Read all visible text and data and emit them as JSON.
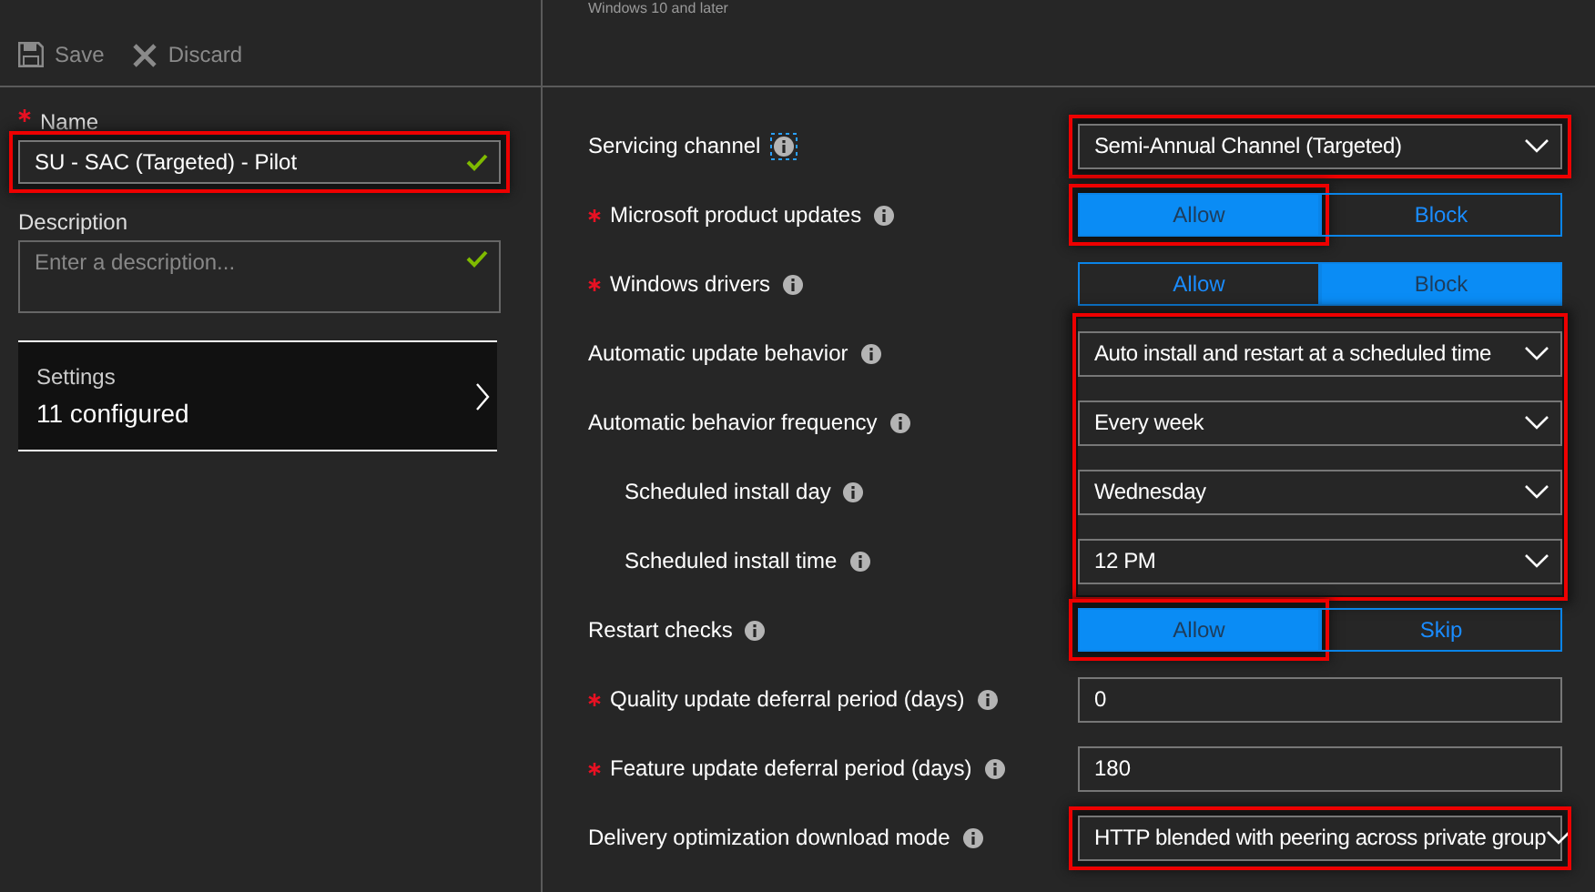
{
  "left": {
    "toolbar": [
      {
        "kind": "save",
        "label": "Save",
        "disabled": true
      },
      {
        "kind": "discard",
        "label": "Discard",
        "disabled": true
      }
    ],
    "name": {
      "label": "Name",
      "required": true,
      "value": "SU - SAC (Targeted) - Pilot",
      "valid": true,
      "highlighted": true
    },
    "description": {
      "label": "Description",
      "placeholder": "Enter a description...",
      "valid": true
    },
    "settings_card": {
      "title": "Settings",
      "value": "11 configured"
    }
  },
  "platform": "Windows 10 and later",
  "rows": [
    {
      "kind": "dropdown",
      "label": "Servicing channel",
      "required": false,
      "info_focused": true,
      "value": "Semi-Annual Channel (Targeted)",
      "highlighted": true
    },
    {
      "kind": "toggle",
      "label": "Microsoft product updates",
      "required": true,
      "info_focused": false,
      "options": [
        {
          "label": "Allow",
          "selected": true
        },
        {
          "label": "Block",
          "selected": false
        }
      ],
      "highlighted": true
    },
    {
      "kind": "toggle",
      "label": "Windows drivers",
      "required": true,
      "info_focused": false,
      "options": [
        {
          "label": "Allow",
          "selected": false
        },
        {
          "label": "Block",
          "selected": true
        }
      ],
      "highlighted": false
    },
    {
      "kind": "group",
      "highlighted": true,
      "rows": [
        {
          "kind": "dropdown",
          "label": "Automatic update behavior",
          "required": false,
          "info_focused": false,
          "value": "Auto install and restart at a scheduled time"
        },
        {
          "kind": "dropdown",
          "label": "Automatic behavior frequency",
          "required": false,
          "info_focused": false,
          "value": "Every week",
          "children": [
            {
              "kind": "dropdown",
              "label": "Scheduled install day",
              "required": false,
              "info_focused": false,
              "value": "Wednesday"
            },
            {
              "kind": "dropdown",
              "label": "Scheduled install time",
              "required": false,
              "info_focused": false,
              "value": "12 PM"
            }
          ]
        }
      ]
    },
    {
      "kind": "toggle",
      "label": "Restart checks",
      "required": false,
      "info_focused": false,
      "options": [
        {
          "label": "Allow",
          "selected": true
        },
        {
          "label": "Skip",
          "selected": false
        }
      ],
      "highlighted": true
    },
    {
      "kind": "input",
      "label": "Quality update deferral period (days)",
      "required": true,
      "info_focused": false,
      "value": "0",
      "highlighted": false
    },
    {
      "kind": "input",
      "label": "Feature update deferral period (days)",
      "required": true,
      "info_focused": false,
      "value": "180",
      "highlighted": false
    },
    {
      "kind": "dropdown",
      "label": "Delivery optimization download mode",
      "required": false,
      "info_focused": false,
      "value": "HTTP blended with peering across private group",
      "highlighted": true
    }
  ]
}
